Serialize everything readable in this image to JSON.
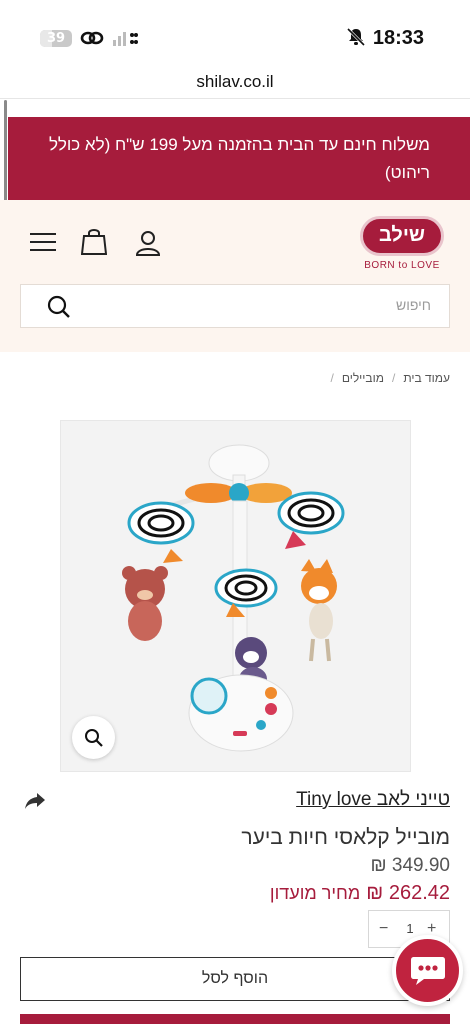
{
  "status_bar": {
    "time": "18:33",
    "battery_level": "39",
    "battery_fraction": 0.39
  },
  "browser": {
    "url": "shilav.co.il"
  },
  "promo": {
    "text": "משלוח חינם עד הבית בהזמנה מעל 199 ש\"ח (לא כולל ריהוט)"
  },
  "header": {
    "logo_text": "שילב",
    "logo_tagline": "BORN to LOVE",
    "icons": [
      "menu-icon",
      "bag-icon",
      "user-icon"
    ]
  },
  "search": {
    "placeholder": "חיפוש"
  },
  "breadcrumb": {
    "items": [
      "עמוד בית",
      "מוביילים"
    ]
  },
  "product": {
    "brand": "טייני לאב Tiny love",
    "title": "מובייל קלאסי חיות ביער",
    "price": "349.90 ₪",
    "club_price_value": "262.42 ₪",
    "club_price_label": "מחיר מועדון",
    "quantity": "1",
    "qty_minus": "−",
    "qty_plus": "+",
    "add_to_cart": "הוסף לסל"
  },
  "colors": {
    "brand": "#a61c3c",
    "header_bg": "#fdf5ef"
  }
}
